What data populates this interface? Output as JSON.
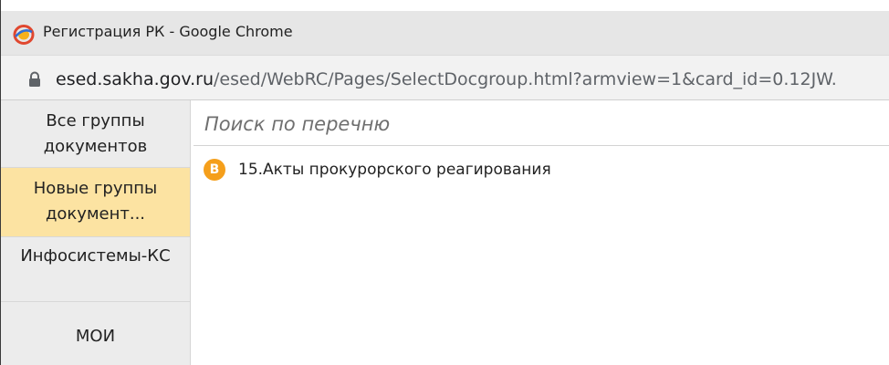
{
  "window": {
    "title": "Регистрация РК - Google Chrome",
    "url_host": "esed.sakha.gov.ru",
    "url_path": "/esed/WebRC/Pages/SelectDocgroup.html?armview=1&card_id=0.12JW."
  },
  "sidebar": {
    "items": [
      {
        "label": "Все группы документов",
        "active": false
      },
      {
        "label": "Новые группы документ...",
        "active": true
      },
      {
        "label": "Инфосистемы-КС",
        "active": false
      },
      {
        "label": "МОИ",
        "active": false
      }
    ]
  },
  "search": {
    "placeholder": "Поиск по перечню",
    "value": ""
  },
  "list": {
    "items": [
      {
        "badge": "В",
        "label": "15.Акты прокурорского реагирования"
      }
    ]
  },
  "colors": {
    "accent_active": "#fce3a2",
    "badge": "#f59f1b",
    "sidebar_bg": "#ececec"
  }
}
